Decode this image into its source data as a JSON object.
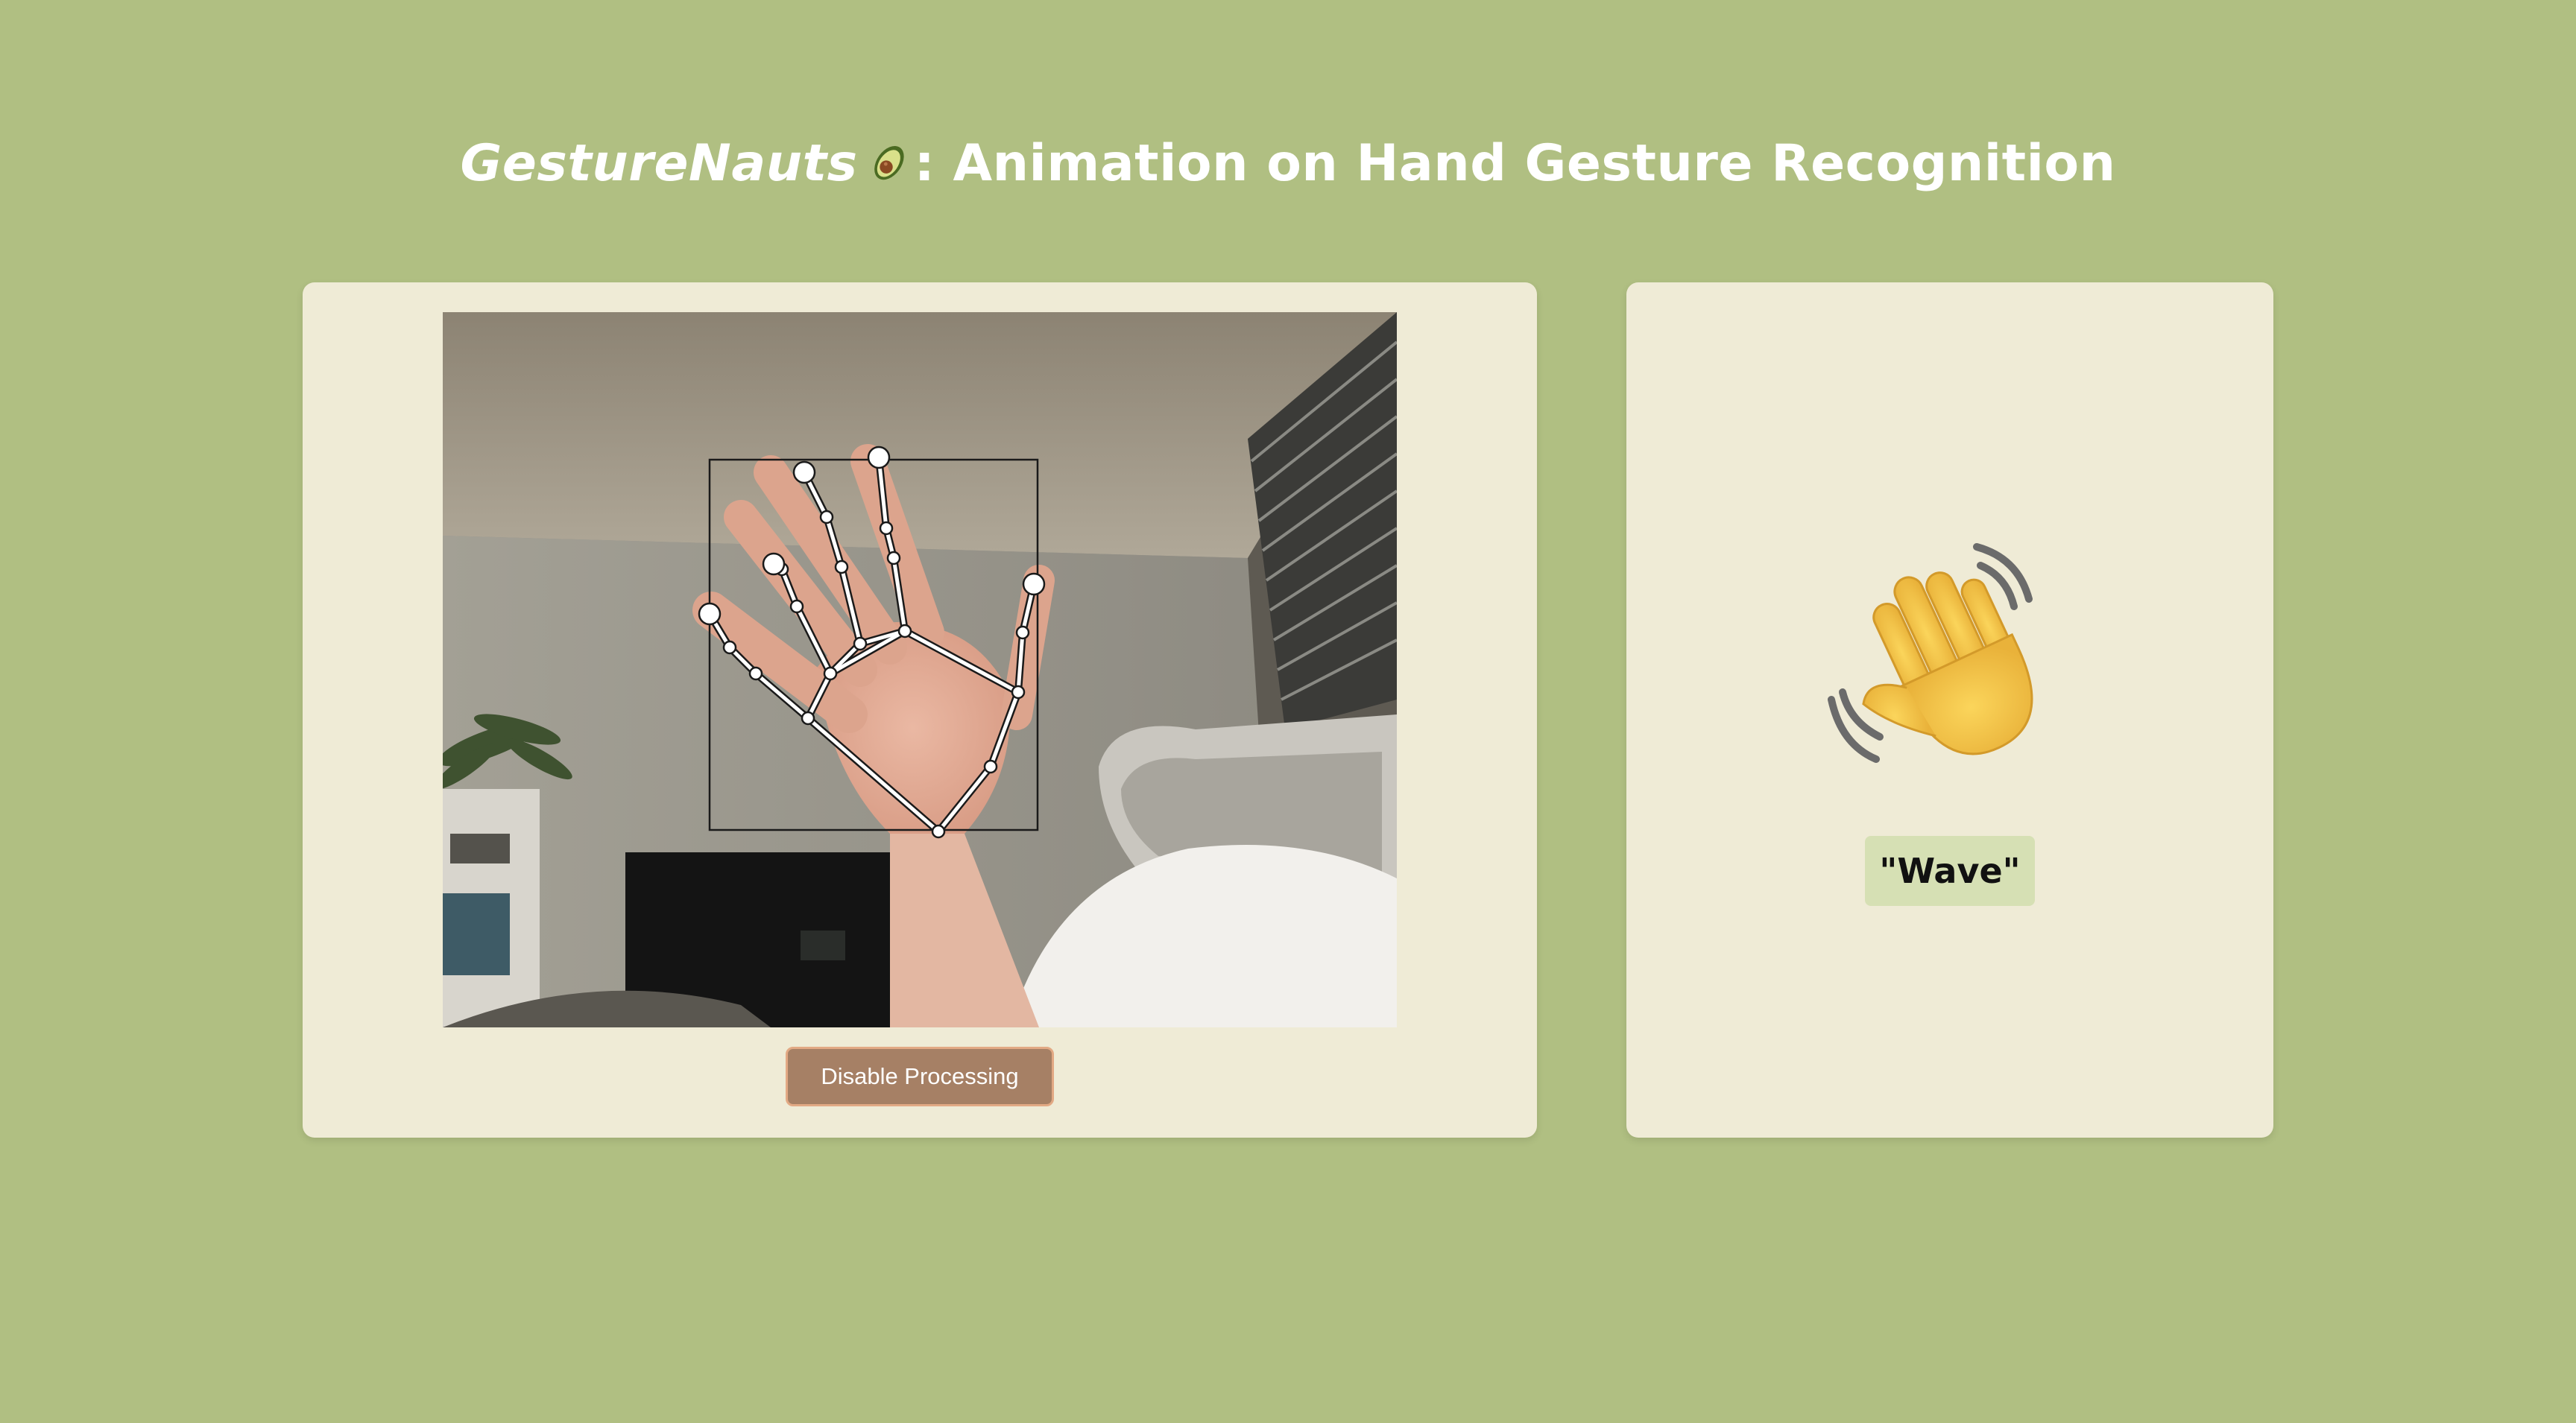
{
  "header": {
    "brand": "GestureNauts",
    "title_rest": ": Animation on Hand Gesture Recognition",
    "brand_icon": "avocado-icon"
  },
  "camera": {
    "hand_detected": true
  },
  "controls": {
    "toggle_button_label": "Disable Processing"
  },
  "result": {
    "gesture_icon": "waving-hand-icon",
    "gesture_label": "\"Wave\""
  },
  "colors": {
    "background": "#b0bf82",
    "panel": "#efebd6",
    "button": "#a68065",
    "button_border": "#e2a984",
    "label_bg": "#d6e0b4"
  }
}
